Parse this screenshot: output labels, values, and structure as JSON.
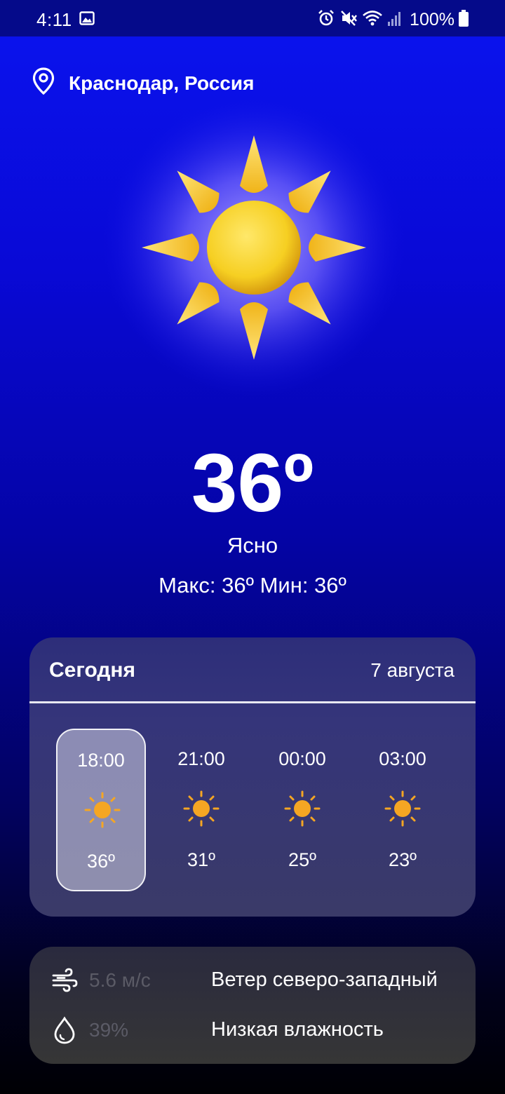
{
  "status_bar": {
    "time": "4:11",
    "battery": "100%",
    "icons": [
      "gallery-icon",
      "alarm-icon",
      "mute-icon",
      "wifi-icon",
      "signal-icon",
      "battery-icon"
    ]
  },
  "location": {
    "name": "Краснодар, Россия",
    "icon": "location-pin-icon"
  },
  "current": {
    "temperature": "36º",
    "condition": "Ясно",
    "minmax": "Макс: 36º Мин: 36º",
    "icon": "sun-icon"
  },
  "today": {
    "title": "Сегодня",
    "date": "7 августа",
    "hours": [
      {
        "time": "18:00",
        "temp": "36º",
        "icon": "sun-icon",
        "selected": true
      },
      {
        "time": "21:00",
        "temp": "31º",
        "icon": "sun-icon",
        "selected": false
      },
      {
        "time": "00:00",
        "temp": "25º",
        "icon": "sun-icon",
        "selected": false
      },
      {
        "time": "03:00",
        "temp": "23º",
        "icon": "sun-icon",
        "selected": false
      }
    ]
  },
  "details": {
    "wind": {
      "value": "5.6 м/с",
      "label": "Ветер северо-западный",
      "icon": "wind-icon"
    },
    "humidity": {
      "value": "39%",
      "label": "Низкая влажность",
      "icon": "droplet-icon"
    }
  },
  "colors": {
    "background_top": "#0a14f0",
    "background_bottom": "#000004",
    "sun": "#f5c518",
    "card": "#35357a"
  }
}
